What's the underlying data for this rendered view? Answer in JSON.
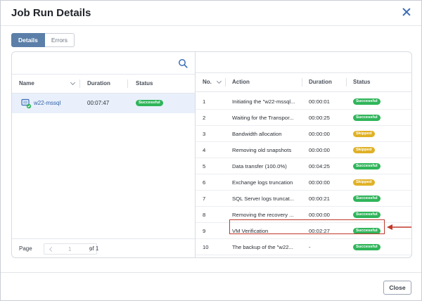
{
  "dialog": {
    "title": "Job Run Details",
    "close_label": "Close"
  },
  "tabs": [
    {
      "label": "Details",
      "active": true
    },
    {
      "label": "Errors",
      "active": false
    }
  ],
  "left_table": {
    "headers": {
      "name": "Name",
      "duration": "Duration",
      "status": "Status"
    },
    "rows": [
      {
        "name": "w22-mssql",
        "duration": "00:07:47",
        "status": "Successful"
      }
    ]
  },
  "pager": {
    "page_label": "Page",
    "page": "1",
    "of_label": "of 1"
  },
  "right_table": {
    "headers": {
      "no": "No.",
      "action": "Action",
      "duration": "Duration",
      "status": "Status"
    },
    "rows": [
      {
        "no": "1",
        "action": "Initiating the \"w22-mssql...",
        "duration": "00:00:01",
        "status": "Successful",
        "kind": "ok"
      },
      {
        "no": "2",
        "action": "Waiting for the Transpor...",
        "duration": "00:00:25",
        "status": "Successful",
        "kind": "ok"
      },
      {
        "no": "3",
        "action": "Bandwidth allocation",
        "duration": "00:00:00",
        "status": "Skipped",
        "kind": "skip"
      },
      {
        "no": "4",
        "action": "Removing old snapshots",
        "duration": "00:00:00",
        "status": "Skipped",
        "kind": "skip"
      },
      {
        "no": "5",
        "action": "Data transfer (100.0%)",
        "duration": "00:04:25",
        "status": "Successful",
        "kind": "ok"
      },
      {
        "no": "6",
        "action": "Exchange logs truncation",
        "duration": "00:00:00",
        "status": "Skipped",
        "kind": "skip"
      },
      {
        "no": "7",
        "action": "SQL Server logs truncat...",
        "duration": "00:00:21",
        "status": "Successful",
        "kind": "ok"
      },
      {
        "no": "8",
        "action": "Removing the recovery ...",
        "duration": "00:00:00",
        "status": "Successful",
        "kind": "ok"
      },
      {
        "no": "9",
        "action": "VM Verification",
        "duration": "00:02:27",
        "status": "Successful",
        "kind": "ok"
      },
      {
        "no": "10",
        "action": "The backup of the \"w22...",
        "duration": "-",
        "status": "Successful",
        "kind": "ok"
      }
    ]
  },
  "colors": {
    "accent": "#5b7fa8",
    "success": "#2fb55a",
    "skipped": "#e0b126",
    "highlight": "#c0392b",
    "selected_row": "#e9f0fb"
  }
}
